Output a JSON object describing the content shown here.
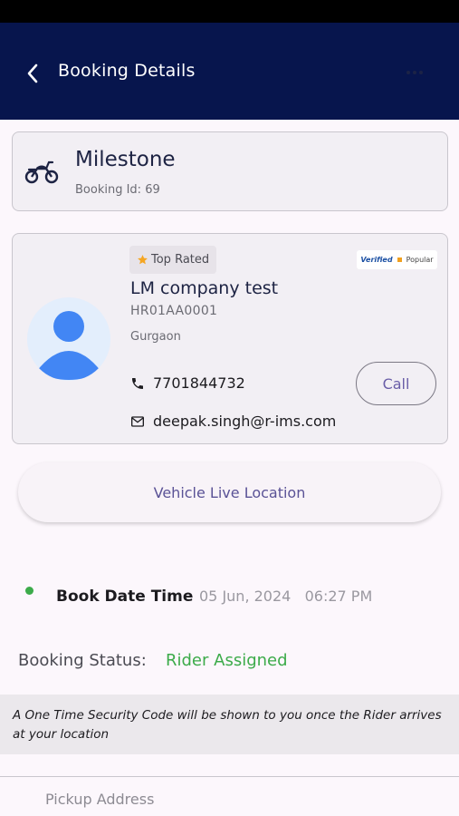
{
  "app_bar": {
    "title": "Booking Details"
  },
  "service": {
    "name": "Milestone",
    "booking_id": "Booking Id: 69"
  },
  "rider": {
    "badge": "Top Rated",
    "verified_label": "Verified",
    "popular_label": "Popular",
    "company": "LM company test",
    "plate": "HR01AA0001",
    "city": "Gurgaon",
    "phone": "7701844732",
    "email": "deepak.singh@r-ims.com",
    "call_label": "Call"
  },
  "live_location_label": "Vehicle Live Location",
  "book_datetime": {
    "label": "Book Date Time",
    "value": "05 Jun, 2024   06:27 PM"
  },
  "booking_status": {
    "label": "Booking Status:",
    "value": "Rider Assigned"
  },
  "security_note": "A One Time Security Code will be shown to you once the Rider arrives at your location",
  "pickup_address_label": "Pickup Address",
  "colors": {
    "app_bar": "#07154d",
    "accent_green": "#3cab4a",
    "accent_purple": "#6a5ea8"
  }
}
